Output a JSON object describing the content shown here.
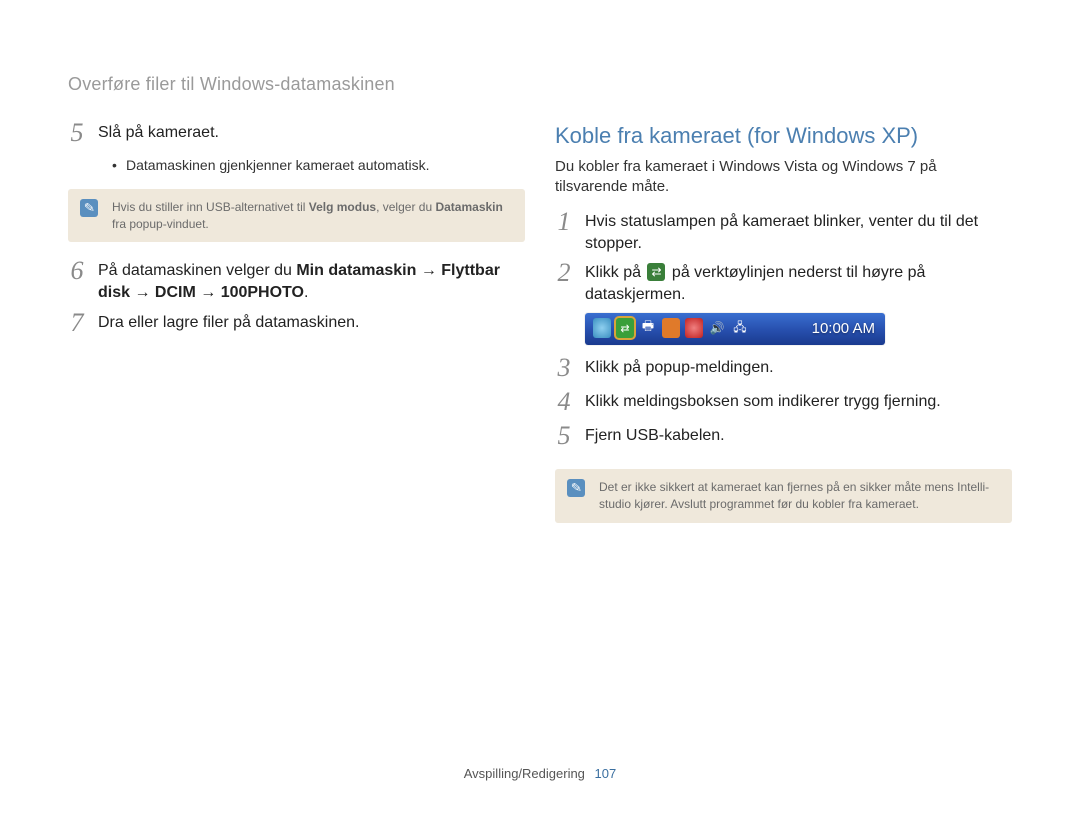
{
  "section_title": "Overføre filer til Windows-datamaskinen",
  "left": {
    "step5": {
      "num": "5",
      "text": "Slå på kameraet.",
      "bullet": "Datamaskinen gjenkjenner kameraet automatisk."
    },
    "note1_a": "Hvis du stiller inn USB-alternativet til ",
    "note1_b": "Velg modus",
    "note1_c": ", velger du ",
    "note1_d": "Datamaskin",
    "note1_e": " fra popup-vinduet.",
    "step6": {
      "num": "6",
      "a": "På datamaskinen velger du ",
      "b": "Min datamaskin",
      "arrow": " → ",
      "c": "Flyttbar disk",
      "d": "DCIM",
      "e": "100PHOTO",
      "dot": "."
    },
    "step7": {
      "num": "7",
      "text": "Dra eller lagre filer på datamaskinen."
    }
  },
  "right": {
    "title": "Koble fra kameraet (for Windows XP)",
    "subtitle": "Du kobler fra kameraet i Windows Vista og Windows 7 på tilsvarende måte.",
    "step1": {
      "num": "1",
      "text": "Hvis statuslampen på kameraet blinker, venter du til det stopper."
    },
    "step2": {
      "num": "2",
      "a": "Klikk på ",
      "b": " på verktøylinjen nederst til høyre på dataskjermen."
    },
    "tray_time": "10:00 AM",
    "step3": {
      "num": "3",
      "text": "Klikk på popup-meldingen."
    },
    "step4": {
      "num": "4",
      "text": "Klikk meldingsboksen som indikerer trygg fjerning."
    },
    "step5": {
      "num": "5",
      "text": "Fjern USB-kabelen."
    },
    "note2": "Det er ikke sikkert at kameraet kan fjernes på en sikker måte mens Intelli-studio kjører. Avslutt programmet før du kobler fra kameraet."
  },
  "footer": {
    "label": "Avspilling/Redigering",
    "page": "107"
  }
}
